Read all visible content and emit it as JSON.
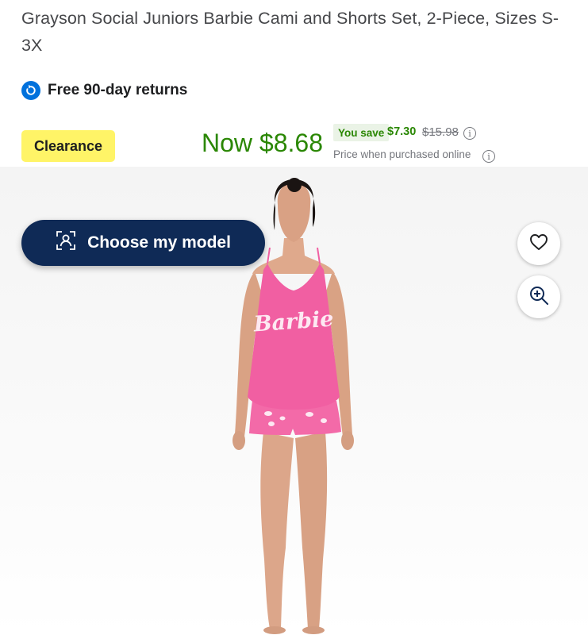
{
  "product": {
    "title": "Grayson Social Juniors Barbie Cami and Shorts Set, 2-Piece, Sizes S-3X",
    "returns_label": "Free 90-day returns",
    "badge": "Clearance",
    "price": {
      "now": "Now $8.68",
      "you_save_label": "You save",
      "save_amount": "$7.30",
      "was": "$15.98",
      "online_note": "Price when purchased online"
    },
    "image_text": "Barbie"
  },
  "actions": {
    "choose_model_label": "Choose my model"
  },
  "colors": {
    "price_green": "#2a8703",
    "clearance_yellow": "#fff467",
    "button_navy": "#0f2a56",
    "returns_blue": "#0071dc",
    "cami_pink": "#f15fa2"
  },
  "icons": [
    "returns-icon",
    "info-icon",
    "model-selector-icon",
    "heart-icon",
    "zoom-in-icon"
  ]
}
